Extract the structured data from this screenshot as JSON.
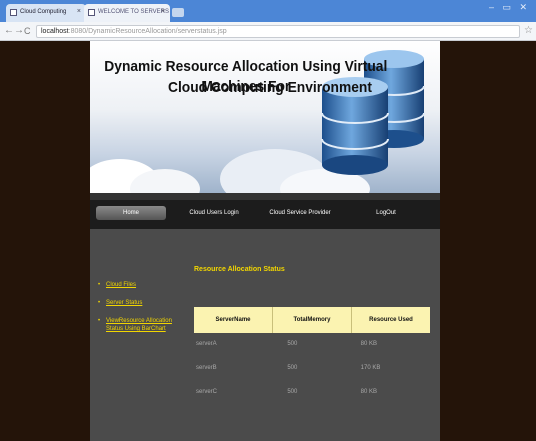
{
  "browser": {
    "tabs": [
      {
        "label": "Cloud Computing"
      },
      {
        "label": "WELCOME TO SERVERS"
      }
    ],
    "window_controls": "– ▭ ✕",
    "url_host": "localhost",
    "url_path": ":8080/DynamicResourceAllocation/serverstatus.jsp"
  },
  "banner": {
    "title_line1": "Dynamic Resource Allocation Using Virtual Machines For",
    "title_line2": "Cloud Computing Environment"
  },
  "menu": {
    "home": "Home",
    "cloud_users_login": "Cloud Users Login",
    "cloud_service_provider": "Cloud Service Provider",
    "logout": "LogOut"
  },
  "sidebar": {
    "items": [
      {
        "label": "Cloud Files"
      },
      {
        "label": "Server Status"
      },
      {
        "label": "ViewResource Allocation Status Using BarChart"
      }
    ]
  },
  "main": {
    "title": "Resource Allocation Status",
    "columns": [
      "ServerName",
      "TotalMemory",
      "Resource Used"
    ],
    "rows": [
      [
        "serverA",
        "500",
        "80 KB"
      ],
      [
        "serverB",
        "500",
        "170 KB"
      ],
      [
        "serverC",
        "500",
        "80 KB"
      ]
    ]
  },
  "colors": {
    "accent_yellow": "#f2d600",
    "table_header": "#fbf3b1",
    "content_bg": "#4b4b4b",
    "page_bg": "#241409",
    "tabstrip": "#4c86d6"
  }
}
